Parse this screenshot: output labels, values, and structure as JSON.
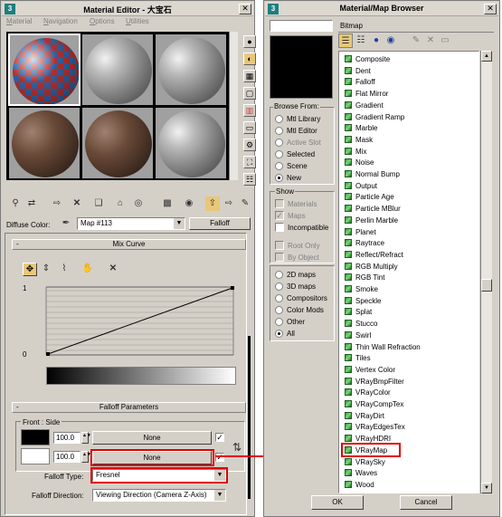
{
  "mat_editor": {
    "title": "Material Editor - 大宝石",
    "menu": [
      {
        "u": "M",
        "rest": "aterial"
      },
      {
        "u": "N",
        "rest": "avigation"
      },
      {
        "u": "O",
        "rest": "ptions"
      },
      {
        "u": "U",
        "rest": "tilities"
      }
    ],
    "diffuse_label": "Diffuse Color:",
    "map_name": "Map #113",
    "map_type": "Falloff",
    "mix_curve": {
      "header": "Mix Curve",
      "y_top": "1",
      "y_bottom": "0"
    },
    "falloff_params": {
      "header": "Falloff Parameters",
      "front_side_label": "Front : Side",
      "row1_value": "100.0",
      "row1_map": "None",
      "row2_value": "100.0",
      "row2_map": "None",
      "falloff_type_label": "Falloff Type:",
      "falloff_type_value": "Fresnel",
      "falloff_direction_label": "Falloff Direction:",
      "falloff_direction_value": "Viewing Direction (Camera Z-Axis)"
    }
  },
  "browser": {
    "title": "Material/Map Browser",
    "search_value": "",
    "selected_name": "Bitmap",
    "browse_from_label": "Browse From:",
    "browse_from": [
      "Mtl Library",
      "Mtl Editor",
      "Active Slot",
      "Selected",
      "Scene",
      "New"
    ],
    "browse_from_selected": "New",
    "show_label": "Show",
    "show_options": [
      {
        "label": "Materials",
        "checked": false,
        "enabled": false
      },
      {
        "label": "Maps",
        "checked": true,
        "enabled": false
      },
      {
        "label": "Incompatible",
        "checked": false,
        "enabled": true
      }
    ],
    "root_only": "Root Only",
    "by_object": "By Object",
    "map_filters": [
      "2D maps",
      "3D maps",
      "Compositors",
      "Color Mods",
      "Other",
      "All"
    ],
    "map_filter_selected": "All",
    "maps": [
      "Composite",
      "Dent",
      "Falloff",
      "Flat Mirror",
      "Gradient",
      "Gradient Ramp",
      "Marble",
      "Mask",
      "Mix",
      "Noise",
      "Normal Bump",
      "Output",
      "Particle Age",
      "Particle MBlur",
      "Perlin Marble",
      "Planet",
      "Raytrace",
      "Reflect/Refract",
      "RGB Multiply",
      "RGB Tint",
      "Smoke",
      "Speckle",
      "Splat",
      "Stucco",
      "Swirl",
      "Thin Wall Refraction",
      "Tiles",
      "Vertex Color",
      "VRayBmpFilter",
      "VRayColor",
      "VRayCompTex",
      "VRayDirt",
      "VRayEdgesTex",
      "VRayHDRI",
      "VRayMap",
      "VRaySky",
      "Waves",
      "Wood"
    ],
    "highlighted_map": "VRayMap",
    "ok_label": "OK",
    "cancel_label": "Cancel"
  },
  "colors": {
    "highlight": "#e00000",
    "window_bg": "#d4d0c8"
  }
}
